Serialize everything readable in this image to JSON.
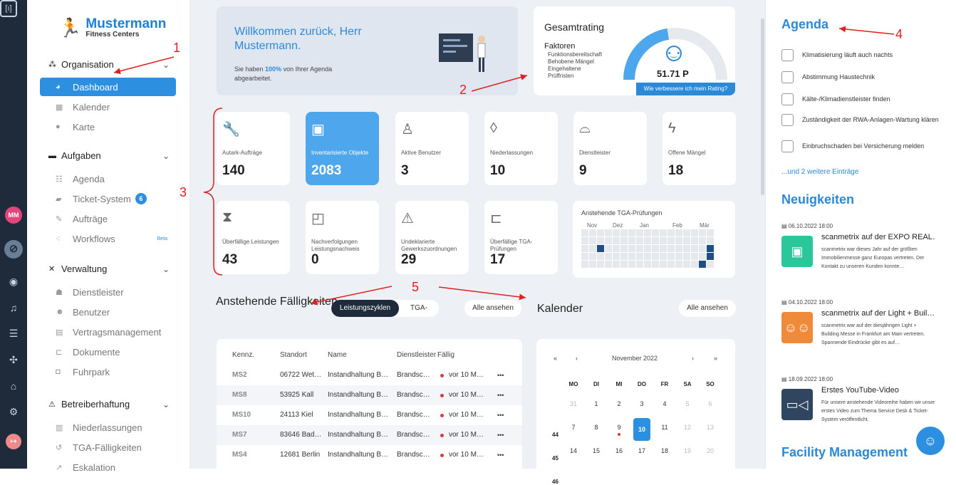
{
  "user_initials": "MM",
  "brand": {
    "name": "Mustermann",
    "sub": "Fitness Centers"
  },
  "sidebar": {
    "organisation": "Organisation",
    "dashboard": "Dashboard",
    "kalender": "Kalender",
    "karte": "Karte",
    "aufgaben": "Aufgaben",
    "agenda": "Agenda",
    "ticket": "Ticket-System",
    "ticket_count": "6",
    "auftraege": "Aufträge",
    "workflows": "Workflows",
    "beta": "Beta",
    "verwaltung": "Verwaltung",
    "dienstleister": "Dienstleister",
    "benutzer": "Benutzer",
    "vertrag": "Vertragsmanagement",
    "dokumente": "Dokumente",
    "fuhrpark": "Fuhrpark",
    "betreiber": "Betreiberhaftung",
    "niederlassungen": "Niederlassungen",
    "tga": "TGA-Fälligkeiten",
    "eskalation": "Eskalation"
  },
  "welcome": {
    "title": "Willkommen zurück, Herr Mustermann.",
    "pre": "Sie haben ",
    "pct": "100%",
    "post": " von Ihrer Agenda abgearbeitet."
  },
  "rating": {
    "title": "Gesamtrating",
    "faktoren": "Faktoren",
    "f1": "Funktionsbereitschaft",
    "f2": "Behobene Mängel",
    "f3": "Eingehaltene",
    "f4": "Prüffristen",
    "points": "51.71 P",
    "button": "Wie verbessere ich mein Rating?",
    "fill": 0.45
  },
  "tiles": [
    {
      "label": "Autark-Aufträge",
      "value": "140"
    },
    {
      "label": "Inventarisierte Objekte",
      "value": "2083"
    },
    {
      "label": "Aktive Benutzer",
      "value": "3"
    },
    {
      "label": "Niederlassungen",
      "value": "10"
    },
    {
      "label": "Dienstleister",
      "value": "9"
    },
    {
      "label": "Offene Mängel",
      "value": "18"
    },
    {
      "label": "Überfällige Leistungen",
      "value": "43"
    },
    {
      "label": "Nachverfolgungen Leistungsnachweis",
      "value": "0"
    },
    {
      "label": "Undeklarierte Gewerkszuordnungen",
      "value": "29"
    },
    {
      "label": "Überfällige TGA-Prüfungen",
      "value": "17"
    }
  ],
  "tga": {
    "title": "Anstehende TGA-Prüfungen",
    "months": [
      "Nov",
      "Dez",
      "Jan",
      "Feb",
      "Mär"
    ]
  },
  "faelligkeiten": {
    "title": "Anstehende Fälligkeiten",
    "tab1": "Leistungszyklen",
    "tab2": "TGA-Anlagen",
    "all": "Alle ansehen"
  },
  "kalender": {
    "title": "Kalender",
    "all": "Alle ansehen",
    "month": "November 2022",
    "nav": [
      "«",
      "‹",
      "›",
      "»"
    ],
    "weekdays": [
      "MO",
      "DI",
      "MI",
      "DO",
      "FR",
      "SA",
      "SO"
    ],
    "weeks": [
      {
        "wk": "",
        "days": [
          "31",
          "1",
          "2",
          "3",
          "4",
          "5",
          "6"
        ]
      },
      {
        "wk": "44",
        "days": [
          "7",
          "8",
          "9",
          "10",
          "11",
          "12",
          "13"
        ]
      },
      {
        "wk": "45",
        "days": [
          "14",
          "15",
          "16",
          "17",
          "18",
          "19",
          "20"
        ]
      },
      {
        "wk": "46",
        "days": []
      }
    ]
  },
  "table": {
    "headers": [
      "Kennz.",
      "Standort",
      "Name",
      "Dienstleister",
      "Fällig"
    ],
    "rows": [
      [
        "MS2",
        "06722 Wet…",
        "Instandhaltung B…",
        "Brandsc…",
        "vor 10 M…"
      ],
      [
        "MS8",
        "53925 Kall",
        "Instandhaltung B…",
        "Brandsc…",
        "vor 10 M…"
      ],
      [
        "MS10",
        "24113 Kiel",
        "Instandhaltung B…",
        "Brandsc…",
        "vor 10 M…"
      ],
      [
        "MS7",
        "83646 Bad…",
        "Instandhaltung B…",
        "Brandsc…",
        "vor 10 M…"
      ],
      [
        "MS4",
        "12681 Berlin",
        "Instandhaltung B…",
        "Brandsc…",
        "vor 10 M…"
      ]
    ],
    "more": "•••"
  },
  "agenda": {
    "title": "Agenda",
    "items": [
      "Klimatisierung läuft auch nachts",
      "Abstimmung Haustechnik",
      "Kälte-/Klimadienstleister finden",
      "Zuständigkeit der RWA-Anlagen-Wartung klären",
      "Einbruchschaden bei Versicherung melden"
    ],
    "more": "...und 2 weitere Einträge"
  },
  "news": {
    "title": "Neuigkeiten",
    "items": [
      {
        "date": "06.10.2022 18:00",
        "title": "scanmetrix auf der EXPO REAL…",
        "text": "scanmetrix war dieses Jahr auf der größten Immobilienmesse ganz Europas vertreten. Der Kontakt zu unseren Kunden konnte…",
        "color": "#2bc79a"
      },
      {
        "date": "04.10.2022 18:00",
        "title": "scanmetrix auf der Light + Buil…",
        "text": "scanmetrix war auf der diesjährigen Light + Building Messe in Frankfurt am Main vertreten. Spannende Eindrücke gibt es auf…",
        "color": "#ef8a3a"
      },
      {
        "date": "18.09.2022 18:00",
        "title": "Erstes YouTube-Video",
        "text": "Für unsere anstehende Videoreihe haben wir unser erstes Video zum Thema Service Desk & Ticket-System veröffentlicht.",
        "color": "#2f4560"
      }
    ]
  },
  "facility": "Facility Management",
  "annotations": [
    "1",
    "2",
    "3",
    "4",
    "5"
  ]
}
